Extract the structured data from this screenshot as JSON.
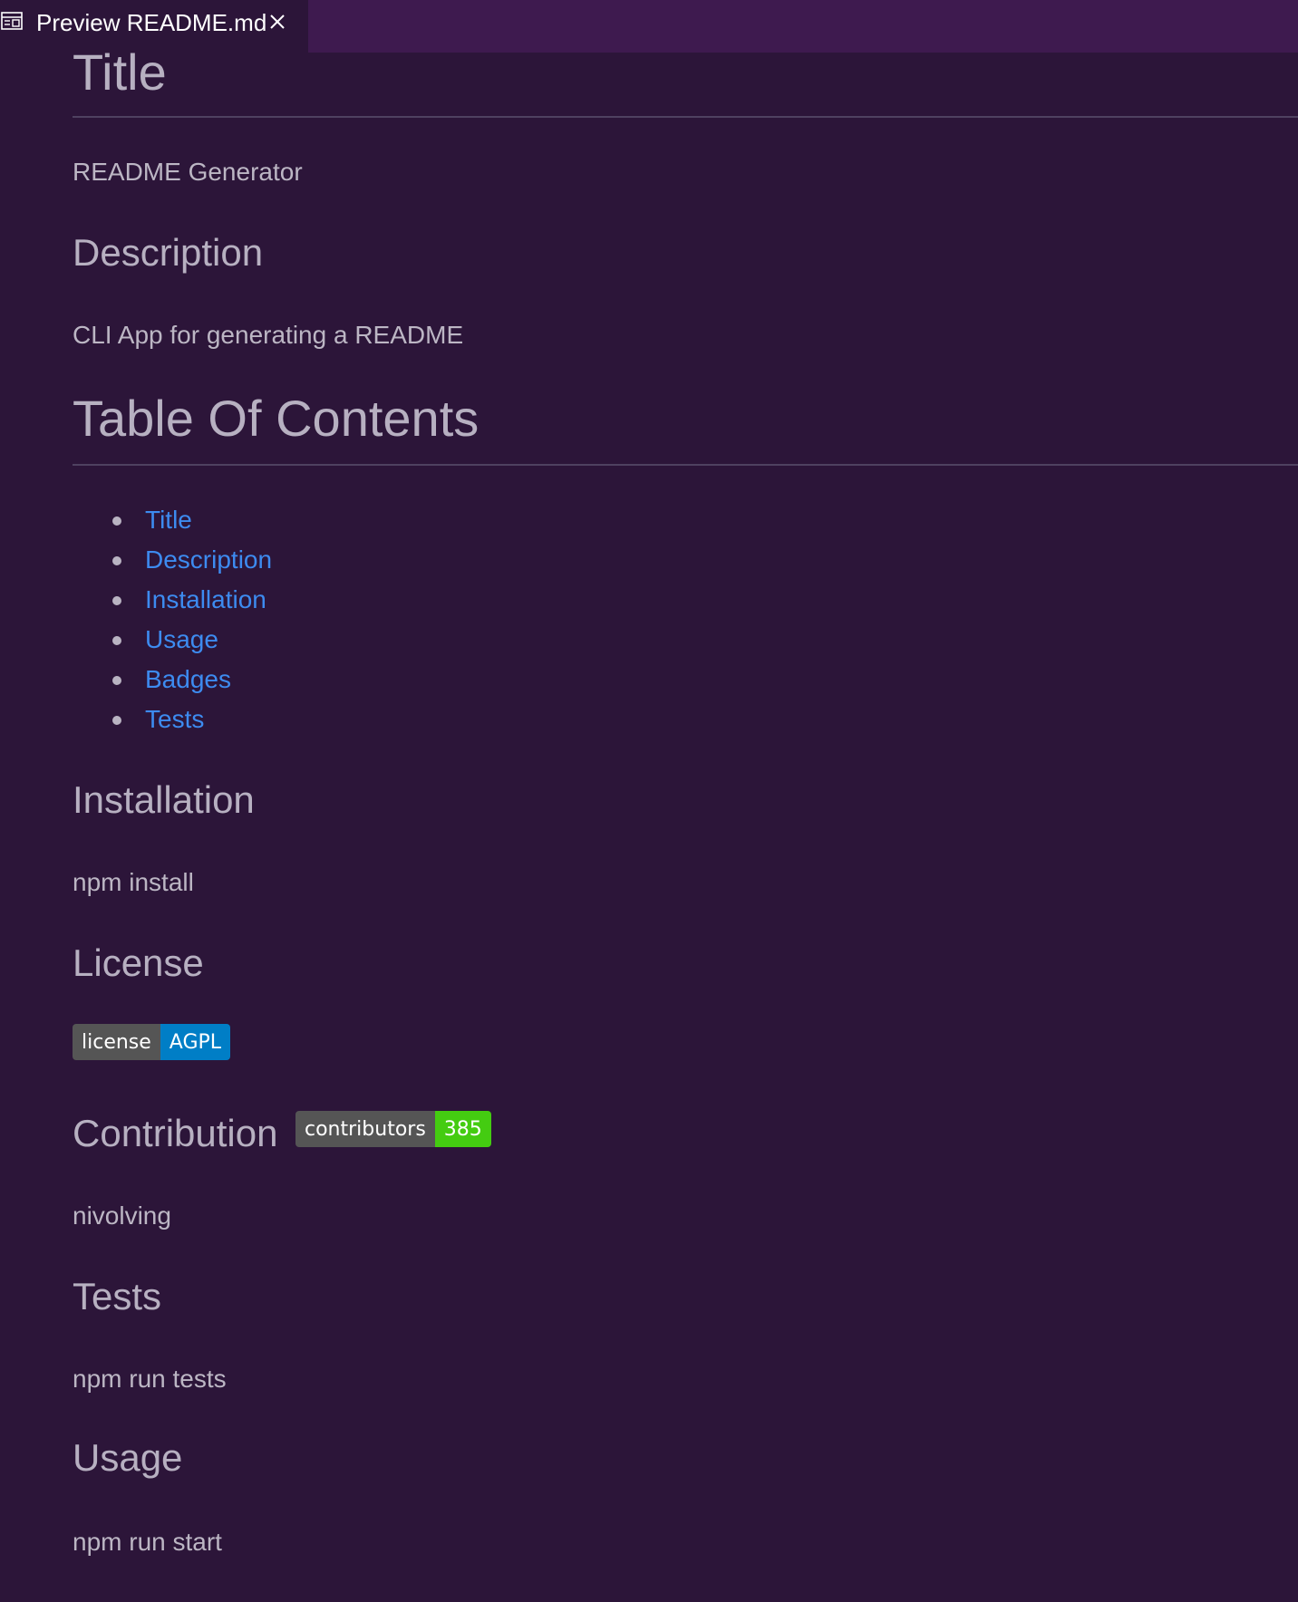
{
  "tab": {
    "label": "Preview README.md",
    "icon": "preview-icon",
    "close_icon": "close-icon"
  },
  "readme": {
    "title_heading": "Title",
    "title_text": "README Generator",
    "description_heading": "Description",
    "description_text": "CLI App for generating a README",
    "toc_heading": "Table Of Contents",
    "toc": [
      "Title",
      "Description",
      "Installation",
      "Usage",
      "Badges",
      "Tests"
    ],
    "installation_heading": "Installation",
    "installation_text": "npm install",
    "license_heading": "License",
    "license_badge": {
      "label": "license",
      "value": "AGPL",
      "color": "#007ec6"
    },
    "contribution_heading": "Contribution",
    "contributors_badge": {
      "label": "contributors",
      "value": "385",
      "color": "#44cc11"
    },
    "contribution_text": "nivolving",
    "tests_heading": "Tests",
    "tests_text": "npm run tests",
    "usage_heading": "Usage",
    "usage_text": "npm run start"
  },
  "colors": {
    "background": "#2c1539",
    "tabbar": "#3e1a4f",
    "link": "#3d8bf0"
  }
}
